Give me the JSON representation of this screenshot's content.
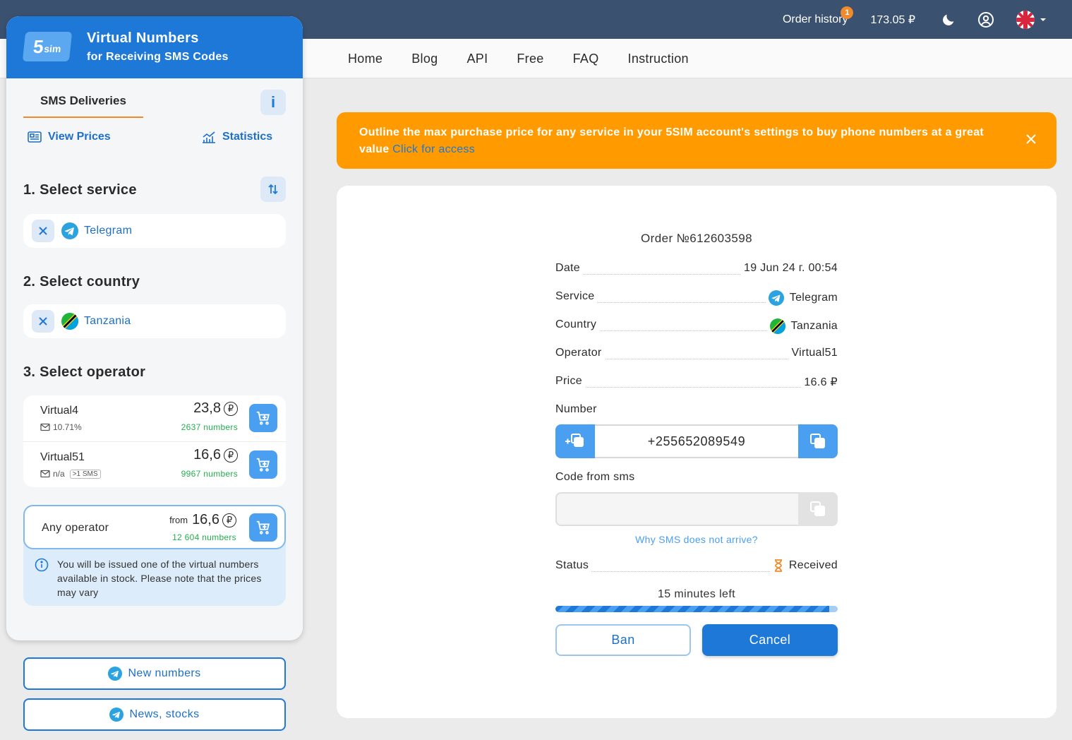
{
  "header": {
    "order_history_label": "Order history",
    "order_history_badge": "1",
    "balance": "173.05 ₽"
  },
  "nav": {
    "links": [
      "Home",
      "Blog",
      "API",
      "Free",
      "FAQ",
      "Instruction"
    ]
  },
  "sidebar": {
    "brand": {
      "logo_main": "5",
      "logo_sub": "sim",
      "title": "Virtual Numbers",
      "subtitle": "for Receiving SMS Codes"
    },
    "tab_active": "SMS Deliveries",
    "info_button": "i",
    "view_prices": "View Prices",
    "statistics": "Statistics",
    "step1_title": "1. Select service",
    "selected_service": "Telegram",
    "step2_title": "2. Select country",
    "selected_country": "Tanzania",
    "step3_title": "3. Select operator",
    "operators": [
      {
        "name": "Virtual4",
        "rate": "10.71%",
        "sms_tag": "",
        "price": "23,8",
        "count": "2637 numbers"
      },
      {
        "name": "Virtual51",
        "rate": "n/a",
        "sms_tag": ">1 SMS",
        "price": "16,6",
        "count": "9967 numbers"
      }
    ],
    "any_operator": {
      "label": "Any operator",
      "from": "from",
      "price": "16,6",
      "count": "12 604 numbers",
      "note": "You will be issued one of the virtual numbers available in stock. Please note that the prices may vary"
    },
    "new_numbers_button": "New numbers",
    "news_button": "News, stocks"
  },
  "banner": {
    "text": "Outline the max purchase price for any service in your 5SIM account's settings to buy phone numbers at a great value",
    "link": "Click for access"
  },
  "order": {
    "title": "Order №612603598",
    "rows": [
      {
        "label": "Date",
        "value": "19 Jun 24 г. 00:54"
      },
      {
        "label": "Service",
        "value": "Telegram"
      },
      {
        "label": "Country",
        "value": "Tanzania"
      },
      {
        "label": "Operator",
        "value": "Virtual51"
      },
      {
        "label": "Price",
        "value": "16.6 ₽"
      }
    ],
    "number_label": "Number",
    "number_value": "+255652089549",
    "code_label": "Code from sms",
    "code_value": "",
    "why_link": "Why SMS does not arrive?",
    "status_label": "Status",
    "status_value": "Received",
    "time_left": "15 minutes left",
    "progress_fraction": 0.97,
    "ban_button": "Ban",
    "cancel_button": "Cancel"
  },
  "colors": {
    "accent": "#1d78d8",
    "header_bg": "#3a5170",
    "banner_bg": "#ff9b00",
    "success": "#22b14c"
  }
}
